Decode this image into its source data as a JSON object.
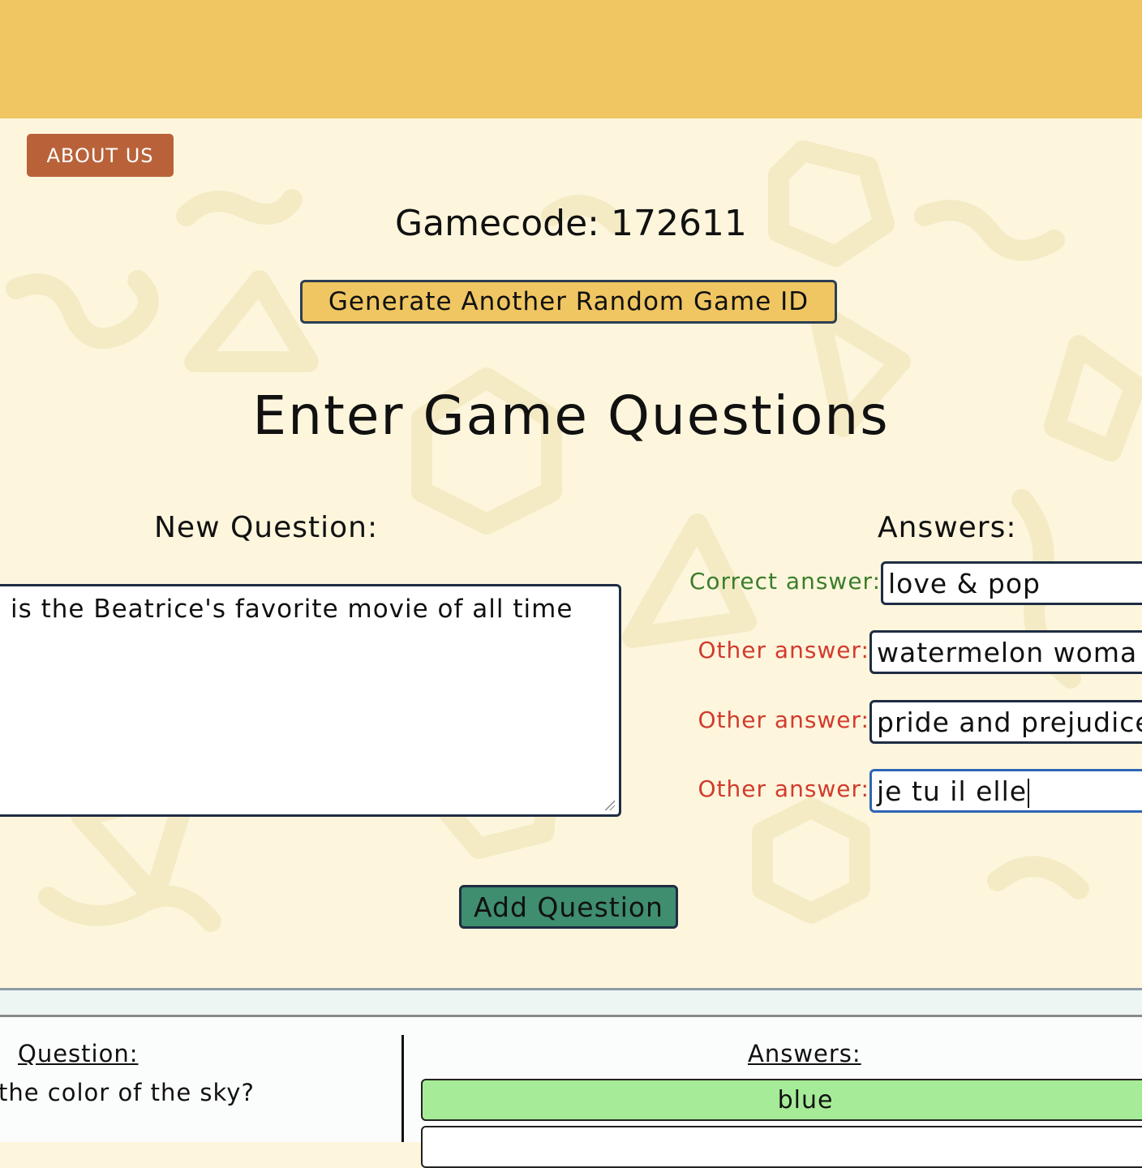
{
  "header": {
    "about_label": "ABOUT US"
  },
  "game": {
    "gamecode_text": "Gamecode: 172611",
    "generate_label": "Generate Another Random Game ID"
  },
  "form": {
    "title": "Enter Game Questions",
    "new_question_label": "New Question:",
    "question_value": "is the Beatrice's favorite movie of all time",
    "answers_label": "Answers:",
    "answers": [
      {
        "label": "Correct answer:",
        "value": "love & pop",
        "kind": "correct"
      },
      {
        "label": "Other answer:",
        "value": "watermelon woma",
        "kind": "other"
      },
      {
        "label": "Other answer:",
        "value": "pride and prejudice",
        "kind": "other"
      },
      {
        "label": "Other answer:",
        "value": "je tu il elle",
        "kind": "other"
      }
    ],
    "add_label": "Add Question"
  },
  "list": {
    "question_header": "Question:",
    "question_text": "the color of the sky?",
    "answers_header": "Answers:",
    "answers": [
      "blue",
      ""
    ]
  },
  "colors": {
    "topbar": "#efc662",
    "about_button": "#b9623a",
    "add_button": "#3e8e6f",
    "correct_label": "#3b7d2a",
    "other_label": "#d33a2c",
    "correct_answer_fill": "#a6ec98"
  }
}
